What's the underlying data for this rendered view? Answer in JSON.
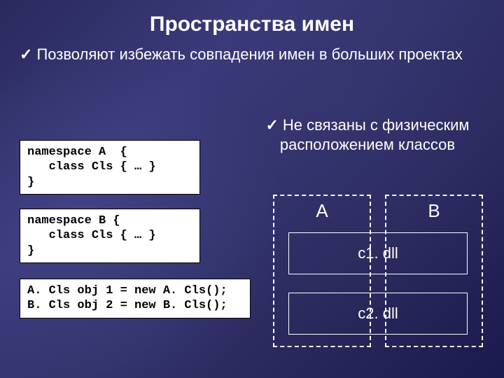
{
  "title": "Пространства имен",
  "bullet1": "Позволяют избежать совпадения имен в больших проектах",
  "bullet2": "Не связаны с физическим расположением  классов",
  "code1": "namespace A  {\n   class Cls { … }\n}",
  "code2": "namespace B {\n   class Cls { … }\n}",
  "code3": "A. Cls obj 1 = new A. Cls();\nB. Cls obj 2 = new B. Cls();",
  "diagram": {
    "labelA": "A",
    "labelB": "B",
    "dll1": "c1. dll",
    "dll2": "c2. dll"
  }
}
